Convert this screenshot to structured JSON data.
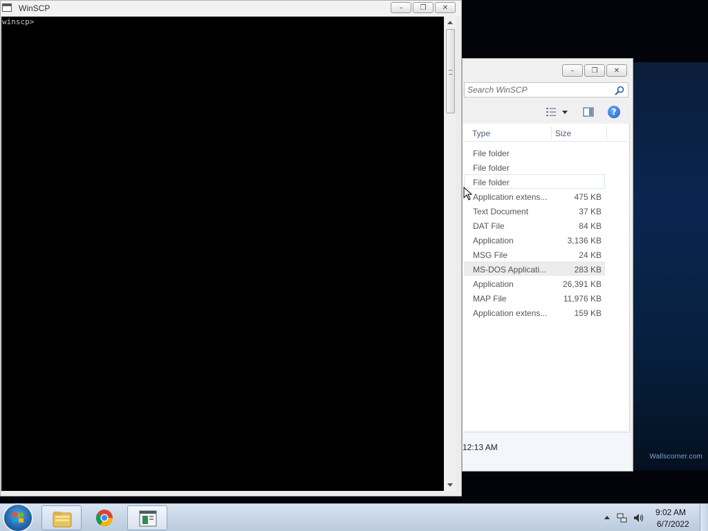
{
  "console": {
    "title": "WinSCP",
    "prompt": "winscp>",
    "buttons": {
      "minimize": "–",
      "restore": "❐",
      "close": "✕"
    }
  },
  "explorer": {
    "buttons": {
      "minimize": "–",
      "restore": "❐",
      "close": "✕"
    },
    "search_placeholder": "Search WinSCP",
    "columns": {
      "type": "Type",
      "size": "Size"
    },
    "rows": [
      {
        "type": "File folder",
        "size": ""
      },
      {
        "type": "File folder",
        "size": ""
      },
      {
        "type": "File folder",
        "size": ""
      },
      {
        "type": "Application extens...",
        "size": "475 KB"
      },
      {
        "type": "Text Document",
        "size": "37 KB"
      },
      {
        "type": "DAT File",
        "size": "84 KB"
      },
      {
        "type": "Application",
        "size": "3,136 KB"
      },
      {
        "type": "MSG File",
        "size": "24 KB"
      },
      {
        "type": "MS-DOS Applicati...",
        "size": "283 KB"
      },
      {
        "type": "Application",
        "size": "26,391 KB"
      },
      {
        "type": "MAP File",
        "size": "11,976 KB"
      },
      {
        "type": "Application extens...",
        "size": "159 KB"
      }
    ],
    "details_time": "12:13 AM"
  },
  "desktop": {
    "wallpaper_mark": "Wallscorner.com"
  },
  "taskbar": {
    "items": [
      "explorer-icon",
      "chrome-icon",
      "winscp-icon"
    ],
    "clock_time": "9:02 AM",
    "clock_date": "6/7/2022"
  },
  "colors": {
    "accent": "#1f5fc4",
    "console_bg": "#000000",
    "taskbar": "#c8d6e8"
  }
}
